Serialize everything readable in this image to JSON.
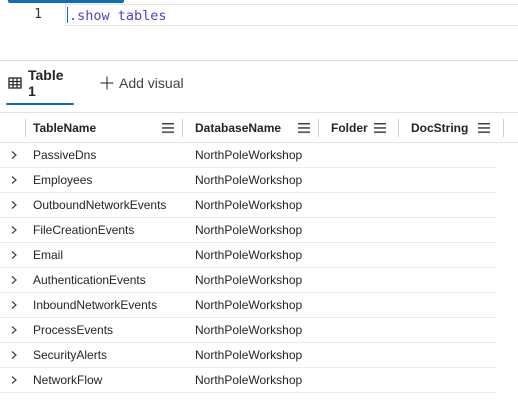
{
  "editor": {
    "line_number": "1",
    "code": ".show tables"
  },
  "tabs": {
    "table_label": "Table 1",
    "add_visual_label": "Add visual"
  },
  "grid": {
    "columns": [
      "TableName",
      "DatabaseName",
      "Folder",
      "DocString"
    ],
    "rows": [
      {
        "table": "PassiveDns",
        "database": "NorthPoleWorkshop",
        "folder": "",
        "docstring": ""
      },
      {
        "table": "Employees",
        "database": "NorthPoleWorkshop",
        "folder": "",
        "docstring": ""
      },
      {
        "table": "OutboundNetworkEvents",
        "database": "NorthPoleWorkshop",
        "folder": "",
        "docstring": ""
      },
      {
        "table": "FileCreationEvents",
        "database": "NorthPoleWorkshop",
        "folder": "",
        "docstring": ""
      },
      {
        "table": "Email",
        "database": "NorthPoleWorkshop",
        "folder": "",
        "docstring": ""
      },
      {
        "table": "AuthenticationEvents",
        "database": "NorthPoleWorkshop",
        "folder": "",
        "docstring": ""
      },
      {
        "table": "InboundNetworkEvents",
        "database": "NorthPoleWorkshop",
        "folder": "",
        "docstring": ""
      },
      {
        "table": "ProcessEvents",
        "database": "NorthPoleWorkshop",
        "folder": "",
        "docstring": ""
      },
      {
        "table": "SecurityAlerts",
        "database": "NorthPoleWorkshop",
        "folder": "",
        "docstring": ""
      },
      {
        "table": "NetworkFlow",
        "database": "NorthPoleWorkshop",
        "folder": "",
        "docstring": ""
      }
    ]
  },
  "colors": {
    "accent": "#0f6cbd",
    "code_text": "#5b3dc5"
  },
  "icons": {
    "table_tab": "table-grid-icon",
    "add_visual": "plus-icon",
    "column_menu": "hamburger-menu-icon",
    "row_expand": "chevron-right-icon"
  }
}
